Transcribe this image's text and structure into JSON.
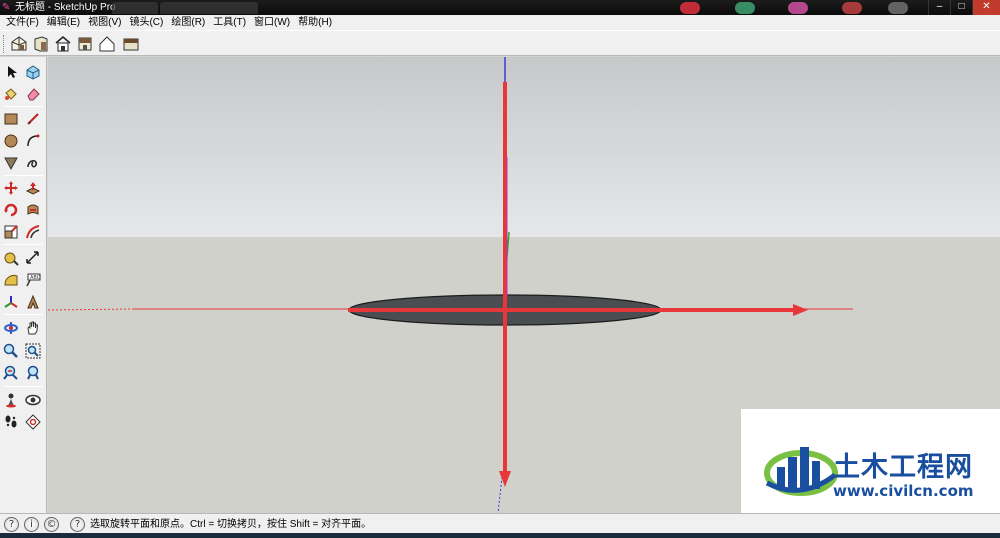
{
  "window": {
    "title": "无标题 - SketchUp Pro",
    "minimize_icon": "minimize-icon",
    "maximize_icon": "maximize-icon",
    "close_icon": "close-icon"
  },
  "menu": [
    {
      "label": "文件(F)"
    },
    {
      "label": "编辑(E)"
    },
    {
      "label": "视图(V)"
    },
    {
      "label": "镜头(C)"
    },
    {
      "label": "绘图(R)"
    },
    {
      "label": "工具(T)"
    },
    {
      "label": "窗口(W)"
    },
    {
      "label": "帮助(H)"
    }
  ],
  "views_toolbar": [
    "iso-view-icon",
    "top-view-icon",
    "front-view-icon",
    "right-view-icon",
    "back-view-icon",
    "left-view-icon"
  ],
  "tools": [
    {
      "name": "select-icon"
    },
    {
      "name": "make-component-icon"
    },
    {
      "name": "paint-bucket-icon"
    },
    {
      "name": "eraser-icon"
    },
    {
      "name": "rectangle-icon"
    },
    {
      "name": "line-icon"
    },
    {
      "name": "circle-icon"
    },
    {
      "name": "arc-icon"
    },
    {
      "name": "polygon-icon"
    },
    {
      "name": "freehand-icon"
    },
    {
      "name": "move-icon"
    },
    {
      "name": "push-pull-icon"
    },
    {
      "name": "rotate-icon"
    },
    {
      "name": "follow-me-icon"
    },
    {
      "name": "scale-icon"
    },
    {
      "name": "offset-icon"
    },
    {
      "name": "tape-measure-icon"
    },
    {
      "name": "dimension-icon"
    },
    {
      "name": "protractor-icon"
    },
    {
      "name": "text-icon"
    },
    {
      "name": "axes-icon"
    },
    {
      "name": "3d-text-icon"
    },
    {
      "name": "orbit-icon"
    },
    {
      "name": "pan-icon"
    },
    {
      "name": "zoom-icon"
    },
    {
      "name": "zoom-window-icon"
    },
    {
      "name": "zoom-extents-icon"
    },
    {
      "name": "previous-view-icon"
    },
    {
      "name": "position-camera-icon"
    },
    {
      "name": "look-around-icon"
    },
    {
      "name": "walk-icon"
    },
    {
      "name": "section-plane-icon"
    }
  ],
  "status": {
    "icons": [
      "geo-location-icon",
      "credits-icon",
      "copyright-icon"
    ],
    "help_icon": "help-icon",
    "message": "选取旋转平面和原点。Ctrl = 切换拷贝，按住 Shift = 对齐平面。"
  },
  "watermark": {
    "brand": "土木工程网",
    "url": "www.civilcn.com"
  },
  "colors": {
    "axis_red": "#e8373a",
    "axis_blue": "#3b3bd6",
    "axis_green": "#2fa62f",
    "disk_fill": "#4a4e52",
    "sky_top": "#c6c8ca",
    "ground": "#d1d1cb",
    "brand_blue": "#1a4fa0",
    "brand_green": "#7ac043"
  }
}
